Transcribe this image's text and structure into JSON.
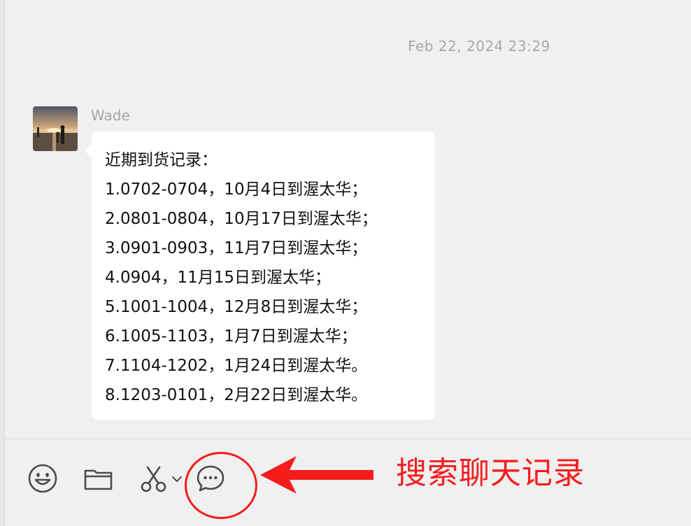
{
  "chat": {
    "timestamp": "Feb 22, 2024 23:29",
    "sender": "Wade",
    "message_lines": [
      "近期到货记录：",
      "1.0702-0704，10月4日到渥太华；",
      "2.0801-0804，10月17日到渥太华；",
      "3.0901-0903，11月7日到渥太华；",
      "4.0904，11月15日到渥太华；",
      "5.1001-1004，12月8日到渥太华；",
      "6.1005-1103，1月7日到渥太华；",
      "7.1104-1202，1月24日到渥太华。",
      "8.1203-0101，2月22日到渥太华。"
    ]
  },
  "toolbar": {
    "icons": [
      "emoji-icon",
      "folder-icon",
      "scissors-icon",
      "chevron-down-icon",
      "chat-history-icon"
    ]
  },
  "annotation": {
    "label": "搜索聊天记录",
    "color": "#f51c1c"
  },
  "colors": {
    "background": "#f0f0f0",
    "bubble": "#ffffff",
    "muted_text": "#a8a8a8",
    "icon": "#4a4a4a"
  }
}
